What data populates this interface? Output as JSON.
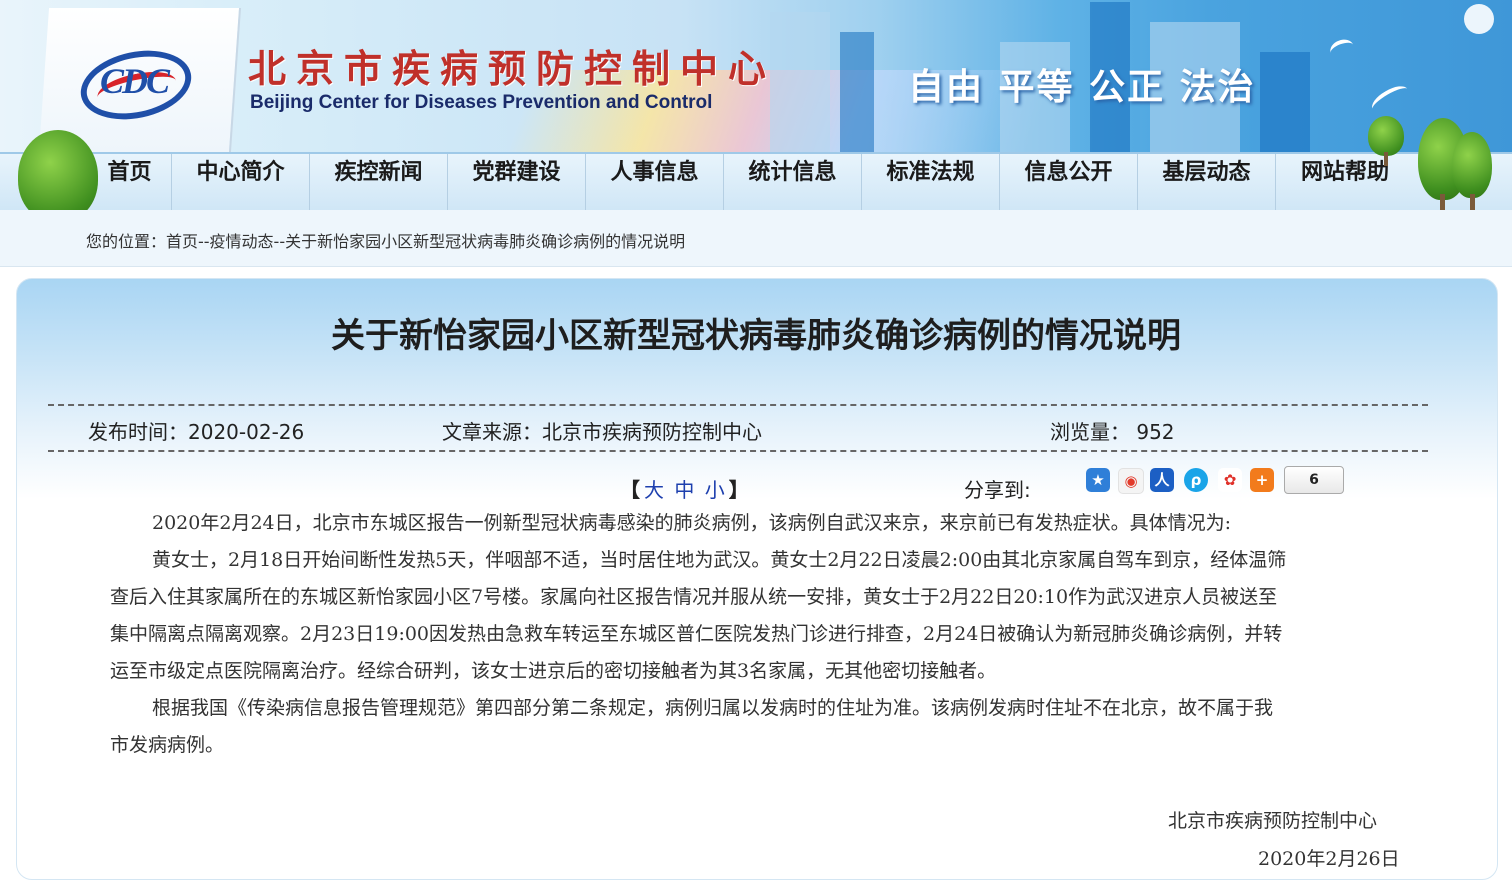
{
  "header": {
    "logo_text": "CDC",
    "site_name_cn": "北京市疾病预防控制中心",
    "site_name_en": "Beijing Center for Diseases Prevention and Control",
    "slogan": "自由 平等 公正 法治"
  },
  "nav": {
    "items": [
      {
        "label": "首页"
      },
      {
        "label": "中心简介"
      },
      {
        "label": "疾控新闻"
      },
      {
        "label": "党群建设"
      },
      {
        "label": "人事信息"
      },
      {
        "label": "统计信息"
      },
      {
        "label": "标准法规"
      },
      {
        "label": "信息公开"
      },
      {
        "label": "基层动态"
      },
      {
        "label": "网站帮助"
      }
    ]
  },
  "breadcrumb": {
    "text": "您的位置：首页--疫情动态--关于新怡家园小区新型冠状病毒肺炎确诊病例的情况说明"
  },
  "article": {
    "title": "关于新怡家园小区新型冠状病毒肺炎确诊病例的情况说明",
    "publish_time": "发布时间：2020-02-26",
    "source": "文章来源：北京市疾病预防控制中心",
    "views": "浏览量：  952",
    "font_size": {
      "open": "【",
      "large": "大",
      "medium": "中",
      "small": "小",
      "close": "】"
    },
    "share_label": "分享到:",
    "share_count": "6",
    "paragraphs": [
      "2020年2月24日，北京市东城区报告一例新型冠状病毒感染的肺炎病例，该病例自武汉来京，来京前已有发热症状。具体情况为:",
      "黄女士，2月18日开始间断性发热5天，伴咽部不适，当时居住地为武汉。黄女士2月22日凌晨2:00由其北京家属自驾车到京，经体温筛",
      "查后入住其家属所在的东城区新怡家园小区7号楼。家属向社区报告情况并服从统一安排，黄女士于2月22日20:10作为武汉进京人员被送至",
      "集中隔离点隔离观察。2月23日19:00因发热由急救车转运至东城区普仁医院发热门诊进行排查，2月24日被确认为新冠肺炎确诊病例，并转",
      "运至市级定点医院隔离治疗。经综合研判，该女士进京后的密切接触者为其3名家属，无其他密切接触者。",
      "根据我国《传染病信息报告管理规范》第四部分第二条规定，病例归属以发病时的住址为准。该病例发病时住址不在北京，故不属于我",
      "市发病病例。"
    ],
    "signature": "北京市疾病预防控制中心",
    "date": "2020年2月26日"
  }
}
